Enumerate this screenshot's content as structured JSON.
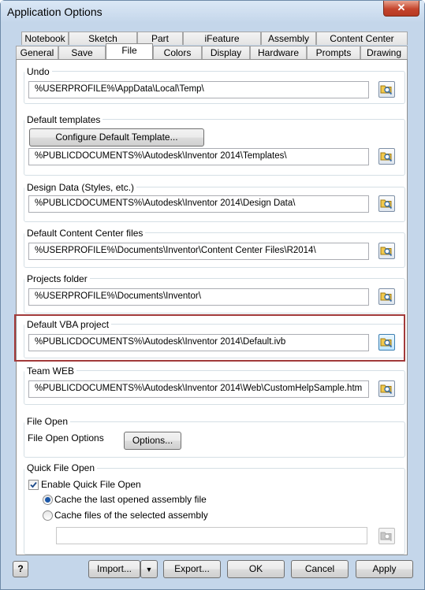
{
  "window": {
    "title": "Application Options",
    "close_glyph": "✕"
  },
  "tabs_row1": [
    "Notebook",
    "Sketch",
    "Part",
    "iFeature",
    "Assembly",
    "Content Center"
  ],
  "tabs_row2": [
    "General",
    "Save",
    "File",
    "Colors",
    "Display",
    "Hardware",
    "Prompts",
    "Drawing"
  ],
  "active_tab": "File",
  "groups": {
    "undo": {
      "label": "Undo",
      "path": "%USERPROFILE%\\AppData\\Local\\Temp\\"
    },
    "templates": {
      "label": "Default templates",
      "button": "Configure Default Template...",
      "path": "%PUBLICDOCUMENTS%\\Autodesk\\Inventor 2014\\Templates\\"
    },
    "design_data": {
      "label": "Design Data (Styles, etc.)",
      "path": "%PUBLICDOCUMENTS%\\Autodesk\\Inventor 2014\\Design Data\\"
    },
    "content_center": {
      "label": "Default Content Center files",
      "path": "%USERPROFILE%\\Documents\\Inventor\\Content Center Files\\R2014\\"
    },
    "projects": {
      "label": "Projects folder",
      "path": "%USERPROFILE%\\Documents\\Inventor\\"
    },
    "vba": {
      "label": "Default VBA project",
      "path": "%PUBLICDOCUMENTS%\\Autodesk\\Inventor 2014\\Default.ivb"
    },
    "team_web": {
      "label": "Team WEB",
      "path": "%PUBLICDOCUMENTS%\\Autodesk\\Inventor 2014\\Web\\CustomHelpSample.htm"
    },
    "file_open": {
      "label": "File Open",
      "options_label": "File Open Options",
      "button": "Options..."
    },
    "quick_open": {
      "label": "Quick File Open",
      "enable": "Enable Quick File Open",
      "radio1": "Cache the last opened assembly file",
      "radio2": "Cache files of the selected assembly",
      "path": ""
    }
  },
  "footer": {
    "help": "?",
    "import": "Import...",
    "dropdown": "▼",
    "export": "Export...",
    "ok": "OK",
    "cancel": "Cancel",
    "apply": "Apply"
  },
  "colors": {
    "highlight": "#a23a3a",
    "active_tab": "#ffffff"
  }
}
